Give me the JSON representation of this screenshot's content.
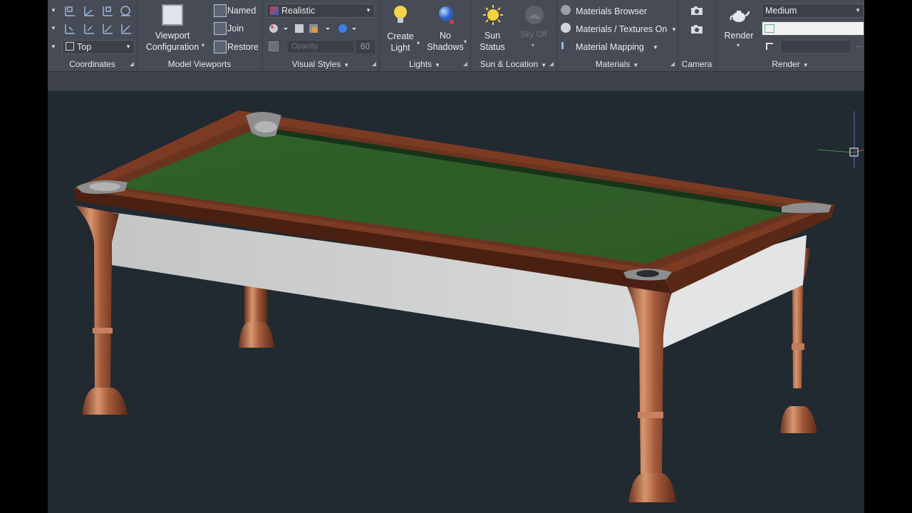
{
  "colors": {
    "ribbon_bg": "#464b55",
    "viewport_bg": "#212931",
    "felt_green": "#2f5e27",
    "wood_brown": "#7a3b22",
    "leg_copper": "#a0583a",
    "apron_grey": "#c9cbcb"
  },
  "panels": {
    "coordinates": {
      "title": "Coordinates",
      "view_combo": "Top"
    },
    "model_viewports": {
      "title": "Model Viewports",
      "viewport_config": "Viewport\nConfiguration",
      "viewport_config_l1": "Viewport",
      "viewport_config_l2": "Configuration",
      "named": "Named",
      "join": "Join",
      "restore": "Restore"
    },
    "visual_styles": {
      "title": "Visual Styles",
      "style_combo": "Realistic",
      "opacity_label": "Opacity",
      "opacity_value": "60"
    },
    "lights": {
      "title": "Lights",
      "create_light_l1": "Create",
      "create_light_l2": "Light",
      "no_shadows_l1": "No",
      "no_shadows_l2": "Shadows"
    },
    "sun_location": {
      "title": "Sun & Location",
      "sun_status_l1": "Sun",
      "sun_status_l2": "Status",
      "sky_off": "Sky Off"
    },
    "materials": {
      "title": "Materials",
      "browser": "Materials Browser",
      "textures": "Materials / Textures On",
      "mapping": "Material Mapping"
    },
    "camera": {
      "title": "Camera"
    },
    "render": {
      "title": "Render",
      "render_button": "Render",
      "quality_combo": "Medium"
    }
  },
  "icons": [
    "ucs-icon",
    "light-bulb-icon",
    "sun-icon",
    "sky-icon",
    "camera-icon",
    "teapot-icon",
    "sphere-icon"
  ]
}
